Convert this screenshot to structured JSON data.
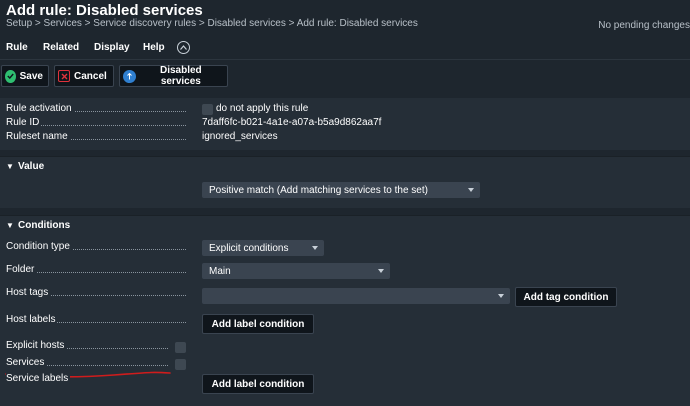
{
  "header": {
    "title": "Add rule: Disabled services",
    "breadcrumb": "Setup > Services > Service discovery rules > Disabled services > Add rule: Disabled services",
    "pending": "No pending changes"
  },
  "menu": {
    "items": [
      "Rule",
      "Related",
      "Display",
      "Help"
    ]
  },
  "toolbar": {
    "save_label": "Save",
    "cancel_label": "Cancel",
    "disabled_services_label": "Disabled services"
  },
  "properties": {
    "rule_activation_label": "Rule activation",
    "rule_activation_value": "do not apply this rule",
    "rule_id_label": "Rule ID",
    "rule_id_value": "7daff6fc-b021-4a1e-a07a-b5a9d862aa7f",
    "ruleset_name_label": "Ruleset name",
    "ruleset_name_value": "ignored_services"
  },
  "value_section": {
    "title": "Value",
    "match_value": "Positive match (Add matching services to the set)"
  },
  "conditions_section": {
    "title": "Conditions",
    "condition_type_label": "Condition type",
    "condition_type_value": "Explicit conditions",
    "folder_label": "Folder",
    "folder_value": "Main",
    "host_tags_label": "Host tags",
    "host_tags_value": "",
    "add_tag_condition": "Add tag condition",
    "host_labels_label": "Host labels",
    "add_host_label_condition": "Add label condition",
    "explicit_hosts_label": "Explicit hosts",
    "services_label": "Services",
    "service_labels_label": "Service labels",
    "add_service_label_condition": "Add label condition"
  },
  "colors": {
    "background": "#1e262e",
    "panel": "#252e37",
    "save_icon": "#2fbf71",
    "cancel_icon": "#e0323c",
    "info_icon": "#2f7fd0",
    "annotation_underline": "#d01c1c"
  }
}
